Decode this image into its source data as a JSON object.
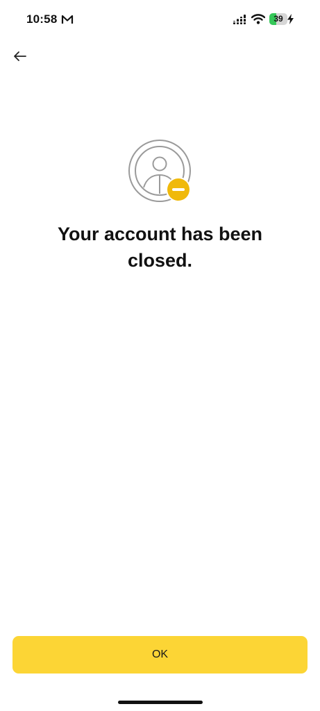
{
  "status_bar": {
    "time": "10:58",
    "battery_level": "39",
    "battery_fraction": 0.39,
    "icons": [
      "mail-icon",
      "signal-icon",
      "wifi-icon",
      "battery-icon",
      "charging-bolt-icon"
    ]
  },
  "nav": {
    "back_icon": "arrow-left-icon"
  },
  "illustration": {
    "icon": "account-closed-icon",
    "accent_color": "#f0b90b"
  },
  "message": {
    "title": "Your account has been closed."
  },
  "actions": {
    "ok_label": "OK",
    "button_color": "#fcd535"
  }
}
